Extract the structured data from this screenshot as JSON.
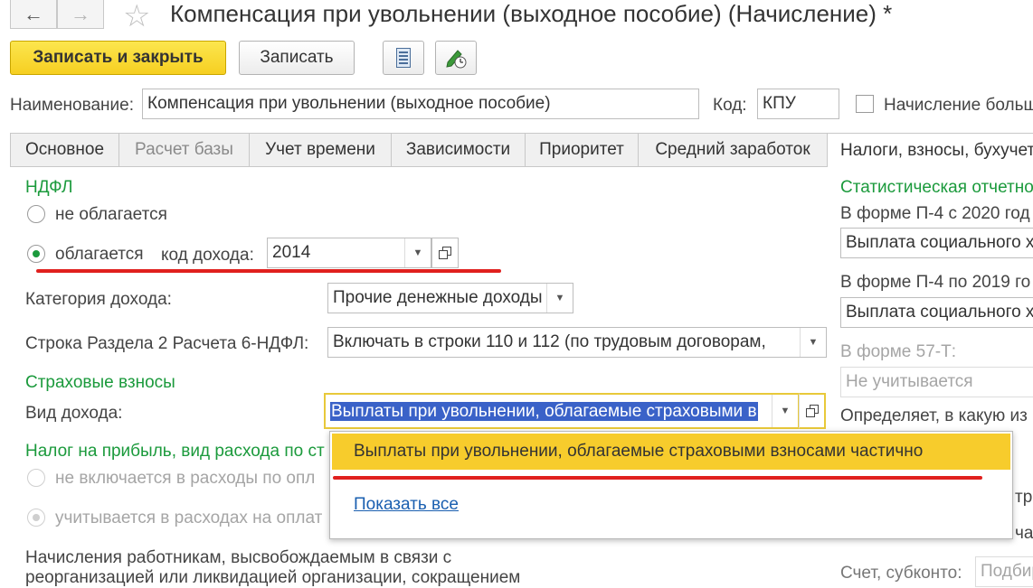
{
  "window": {
    "title": "Компенсация при увольнении (выходное пособие) (Начисление) *"
  },
  "toolbar": {
    "save_close": "Записать и закрыть",
    "save": "Записать"
  },
  "header": {
    "name_label": "Наименование:",
    "name_value": "Компенсация при увольнении (выходное пособие)",
    "code_label": "Код:",
    "code_value": "КПУ",
    "more_label": "Начисление больш"
  },
  "tabs": [
    {
      "label": "Основное"
    },
    {
      "label": "Расчет базы"
    },
    {
      "label": "Учет времени"
    },
    {
      "label": "Зависимости"
    },
    {
      "label": "Приоритет"
    },
    {
      "label": "Средний заработок"
    },
    {
      "label": "Налоги, взносы, бухучет"
    }
  ],
  "ndfl": {
    "heading": "НДФЛ",
    "not_taxed": "не облагается",
    "taxed": "облагается",
    "income_code_label": "код дохода:",
    "income_code_value": "2014",
    "category_label": "Категория дохода:",
    "category_value": "Прочие денежные доходы",
    "row_label": "Строка Раздела 2 Расчета 6-НДФЛ:",
    "row_value": "Включать в строки 110 и 112 (по трудовым договорам,"
  },
  "insurance": {
    "heading": "Страховые взносы",
    "income_type_label": "Вид дохода:",
    "income_type_value": "Выплаты при увольнении, облагаемые страховыми в"
  },
  "profit_tax": {
    "heading": "Налог на прибыль, вид расхода по ст",
    "option1": "не включается в расходы по опл",
    "option2": "учитывается в расходах на оплат",
    "note_line1": "Начисления работникам, высвобождаемым в связи с",
    "note_line2": "реорганизацией или ликвидацией организации, сокращением"
  },
  "dropdown": {
    "option": "Выплаты при увольнении, облагаемые страховыми взносами частично",
    "show_all": "Показать все"
  },
  "statistics": {
    "heading": "Статистическая отчетно",
    "p4_2020_label": "В форме П-4 с 2020 год",
    "p4_2020_value": "Выплата социального х",
    "p4_2019_label": "В форме П-4 по 2019 го",
    "p4_2019_value": "Выплата социального х",
    "f57_label": "В форме 57-Т:",
    "f57_value": "Не учитывается",
    "defines_label": "Определяет, в какую из",
    "frag1": "тр",
    "frag2": "ча",
    "account_label": "Счет, субконто:",
    "account_placeholder": "Подбир"
  }
}
